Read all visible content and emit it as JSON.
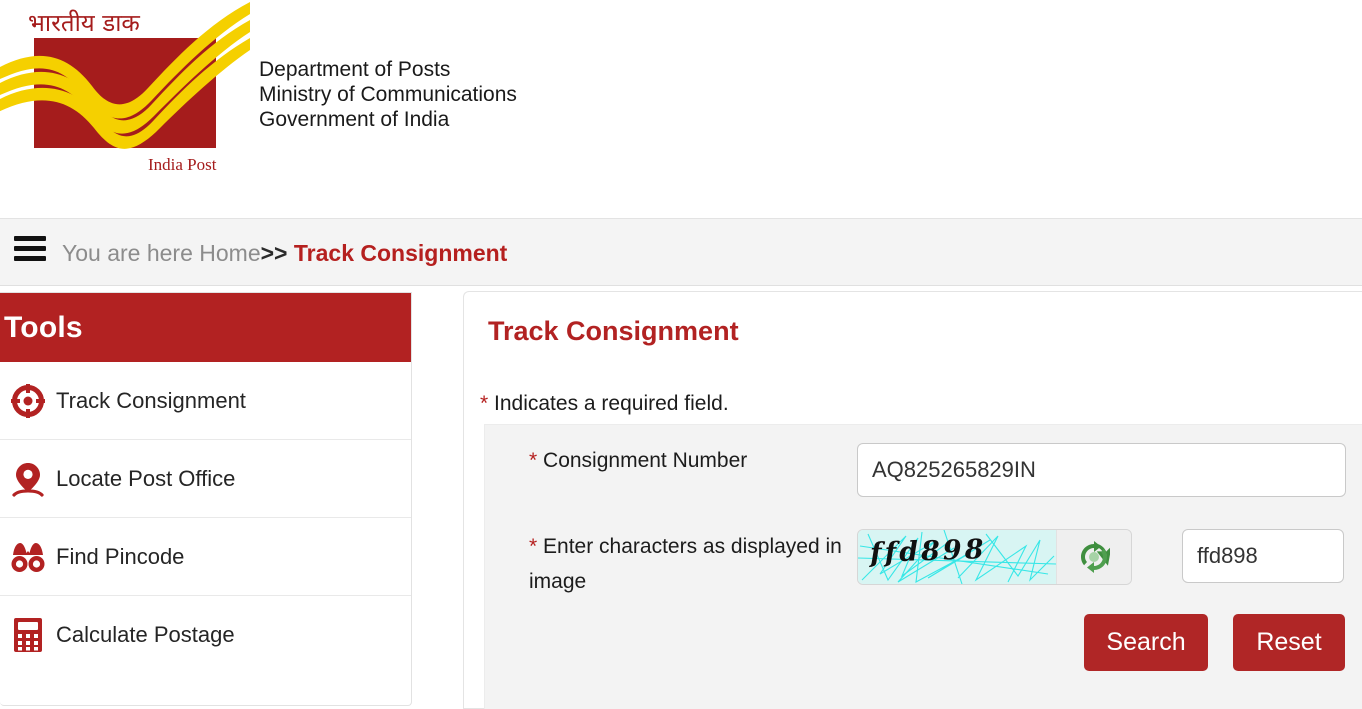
{
  "header": {
    "logo": {
      "hindi_text": "भारतीय डाक",
      "brand_text": "India Post",
      "brand_red": "#a51c1c",
      "swoosh_yellow": "#f5d000",
      "icon_name": "india-post-logo"
    },
    "department_line1": "Department of Posts",
    "department_line2": "Ministry of Communications",
    "department_line3": "Government of India"
  },
  "breadcrumb": {
    "menu_icon": "hamburger-menu-icon",
    "prefix": "You are here Home",
    "separator": ">>",
    "current": "Track Consignment"
  },
  "sidebar": {
    "title": "Tools",
    "header_color": "#b22222",
    "items": [
      {
        "label": "Track Consignment",
        "icon": "crosshair-target-icon"
      },
      {
        "label": "Locate Post Office",
        "icon": "map-pin-icon"
      },
      {
        "label": "Find Pincode",
        "icon": "binoculars-icon"
      },
      {
        "label": "Calculate Postage",
        "icon": "calculator-icon"
      }
    ]
  },
  "main": {
    "title": "Track Consignment",
    "title_color": "#b22222",
    "required_note_star": "*",
    "required_note_text": " Indicates a required field.",
    "form": {
      "consignment": {
        "star": "*",
        "label": " Consignment Number",
        "value": "AQ825265829IN",
        "placeholder": ""
      },
      "captcha": {
        "star": "*",
        "label": " Enter characters as displayed in image",
        "image_text": "ffd898",
        "refresh_icon": "refresh-captcha-icon",
        "refresh_icon_color": "#3f8f3f",
        "input_value": "ffd898",
        "placeholder": ""
      },
      "buttons": {
        "search": "Search",
        "reset": "Reset",
        "button_color": "#b02626"
      }
    }
  }
}
